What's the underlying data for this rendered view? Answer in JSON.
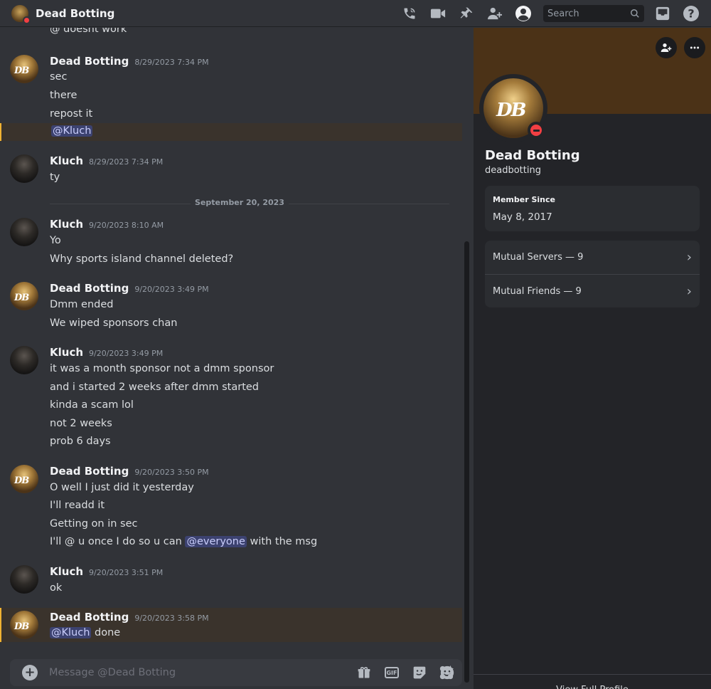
{
  "header": {
    "title": "Dead Botting",
    "search_placeholder": "Search",
    "icons": [
      "phone-icon",
      "video-icon",
      "pin-icon",
      "add-friend-icon",
      "user-profile-icon",
      "search-icon",
      "inbox-icon",
      "help-icon"
    ]
  },
  "chat": {
    "partial_top_line": "@ doesnt work",
    "date_divider": "September 20, 2023",
    "groups": [
      {
        "author": "Dead Botting",
        "timestamp": "8/29/2023 7:34 PM",
        "lines": [
          "sec",
          "there",
          "repost it"
        ],
        "mention_line": "@Kluch"
      },
      {
        "author": "Kluch",
        "timestamp": "8/29/2023 7:34 PM",
        "lines": [
          "ty"
        ]
      },
      {
        "author": "Kluch",
        "timestamp": "9/20/2023 8:10 AM",
        "lines": [
          "Yo",
          "Why sports island channel deleted?"
        ]
      },
      {
        "author": "Dead Botting",
        "timestamp": "9/20/2023 3:49 PM",
        "lines": [
          "Dmm ended",
          "We wiped sponsors chan"
        ]
      },
      {
        "author": "Kluch",
        "timestamp": "9/20/2023 3:49 PM",
        "lines": [
          "it was a month sponsor not a dmm sponsor",
          "and i started 2 weeks after dmm started",
          "kinda a scam lol",
          "not 2 weeks",
          "prob 6 days"
        ]
      },
      {
        "author": "Dead Botting",
        "timestamp": "9/20/2023 3:50 PM",
        "lines": [
          "O well I just did it yesterday",
          "I'll readd it",
          "Getting on in sec"
        ],
        "mention_msg": {
          "before": "I'll @ u once I do so u can ",
          "mention": "@everyone",
          "after": " with the msg"
        }
      },
      {
        "author": "Kluch",
        "timestamp": "9/20/2023 3:51 PM",
        "lines": [
          "ok"
        ]
      },
      {
        "author": "Dead Botting",
        "timestamp": "9/20/2023 3:58 PM",
        "mention_msg": {
          "mention": "@Kluch",
          "after": " done"
        }
      }
    ]
  },
  "composer": {
    "placeholder": "Message @Dead Botting",
    "gif_label": "GIF"
  },
  "profile": {
    "display_name": "Dead Botting",
    "username": "deadbotting",
    "member_since_label": "Member Since",
    "member_since_value": "May 8, 2017",
    "mutual_servers": "Mutual Servers — 9",
    "mutual_friends": "Mutual Friends — 9",
    "view_full_profile": "View Full Profile",
    "status": "do-not-disturb",
    "banner_color": "#4b3217"
  }
}
